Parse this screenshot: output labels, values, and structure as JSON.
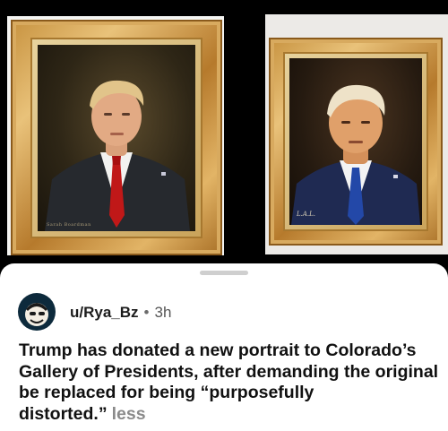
{
  "post": {
    "username": "u/Rya_Bz",
    "separator": "•",
    "age": "3h",
    "text": "Trump has donated a new portrait to Colorado’s Gallery of Presidents, after demanding the original be replaced for being “purposefully distorted.”",
    "less_label": "less"
  },
  "media": {
    "left_signature": "Sarah Boardman",
    "right_signature": "L.A.L."
  },
  "colors": {
    "frame_gold": "#c7923f",
    "sheet_bg": "#ffffff",
    "text_primary": "#111111",
    "text_muted": "#8a8a8a"
  }
}
